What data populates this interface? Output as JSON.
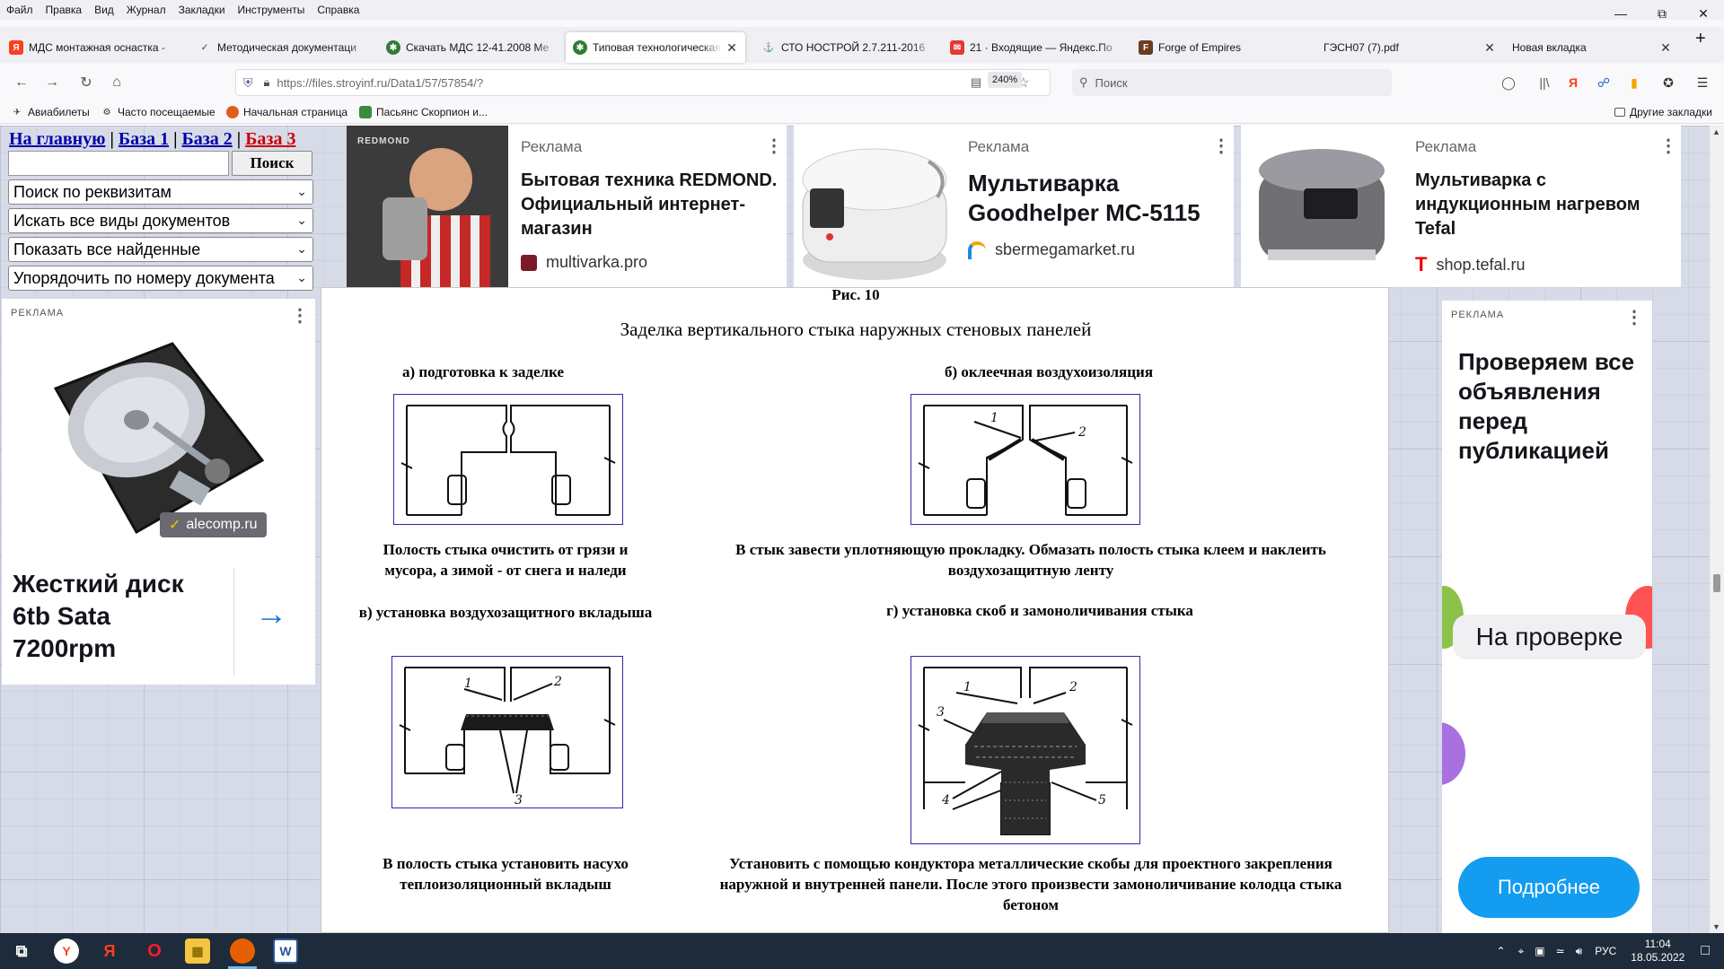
{
  "menu": [
    "Файл",
    "Правка",
    "Вид",
    "Журнал",
    "Закладки",
    "Инструменты",
    "Справка"
  ],
  "tabs": [
    {
      "title": "МДС монтажная оснастка - ",
      "active": false,
      "icon": "yandex-icon",
      "icon_color": "#fc3f1d"
    },
    {
      "title": "Методическая документаци",
      "active": false,
      "icon": "document-icon",
      "icon_color": "#8a6d3b"
    },
    {
      "title": "Скачать МДС 12-41.2008 Ме",
      "active": false,
      "icon": "stroyinf-icon",
      "icon_color": "#2e7d32"
    },
    {
      "title": "Типовая технологическая к",
      "active": true,
      "icon": "stroyinf-icon",
      "icon_color": "#2e7d32"
    },
    {
      "title": "СТО НОСТРОЙ 2.7.211-2016",
      "active": false,
      "icon": "ship-icon",
      "icon_color": "#6b7a99"
    },
    {
      "title": "21 · Входящие — Яндекс.По",
      "active": false,
      "icon": "mail-icon",
      "icon_color": "#e53935"
    },
    {
      "title": "Forge of Empires",
      "active": false,
      "icon": "game-icon",
      "icon_color": "#6d3b1f"
    },
    {
      "title": "ГЭСН07 (7).pdf",
      "active": false,
      "icon": "",
      "icon_color": ""
    },
    {
      "title": "Новая вкладка",
      "active": false,
      "icon": "",
      "icon_color": ""
    }
  ],
  "nav": {
    "url": "https://files.stroyinf.ru/Data1/57/57854/?",
    "zoom": "240%",
    "search_placeholder": "Поиск"
  },
  "bookmarks": [
    "Авиабилеты",
    "Часто посещаемые",
    "Начальная страница",
    "Пасьянс Скорпион и...",
    "Другие закладки"
  ],
  "site": {
    "home": "На главную",
    "sep": "|",
    "base1": "База 1",
    "base2": "База 2",
    "base3": "База 3",
    "search_button": "Поиск",
    "selects": [
      "Поиск по реквизитам",
      "Искать все виды документов",
      "Показать все найденные",
      "Упорядочить по номеру документа"
    ]
  },
  "ads": {
    "left": {
      "label": "РЕКЛАМА",
      "badge": "alecomp.ru",
      "title": "Жесткий диск 6tb Sata 7200rpm"
    },
    "top1": {
      "label": "Реклама",
      "brand": "REDMOND",
      "title": "Бытовая техника REDMOND. Официальный интернет-магазин",
      "site": "multivarka.pro"
    },
    "top2": {
      "label": "Реклама",
      "title": "Мультиварка Goodhelper MC-5115",
      "site": "sbermegamarket.ru"
    },
    "top3": {
      "label": "Реклама",
      "title": "Мультиварка с индукционным нагревом Tefal",
      "site": "shop.tefal.ru"
    },
    "right": {
      "label": "РЕКЛАМА",
      "title": "Проверяем все объявления перед публикацией",
      "badge": "На проверке",
      "button": "Подробнее"
    }
  },
  "doc": {
    "fig_label": "Рис. 10",
    "title": "Заделка вертикального стыка наружных стеновых панелей",
    "a_title": "а) подготовка к заделке",
    "b_title": "б) оклеечная воздухоизоляция",
    "c_title": "в) установка воздухозащитного вкладыша",
    "d_title": "г) установка скоб и замоноличивания стыка",
    "a_caption": "Полость стыка очистить от грязи и мусора, а зимой - от снега и наледи",
    "b_caption": "В стык завести уплотняющую прокладку. Обмазать полость стыка клеем и наклеить воздухозащитную ленту",
    "c_caption": "В полость стыка установить насухо теплоизоляционный вкладыш",
    "d_caption": "Установить с помощью кондуктора металлические скобы для проектного закрепления наружной и внутренней панели. После этого произвести замоноличивание колодца стыка бетоном",
    "labels": [
      "1",
      "2",
      "3",
      "4",
      "5"
    ]
  },
  "taskbar": {
    "lang": "РУС",
    "time": "11:04",
    "date": "18.05.2022"
  }
}
